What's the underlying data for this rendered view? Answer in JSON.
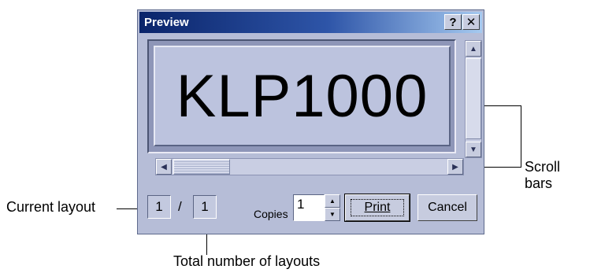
{
  "dialog": {
    "title": "Preview",
    "help_label": "?",
    "close_label": "✕"
  },
  "preview": {
    "label_text": "KLP1000"
  },
  "controls": {
    "current_layout": "1",
    "separator": "/",
    "total_layouts": "1",
    "copies_label": "Copies",
    "copies_value": "1",
    "print_label": "Print",
    "cancel_label": "Cancel"
  },
  "callouts": {
    "scroll_bars": "Scroll bars",
    "current_layout": "Current layout",
    "total_layouts": "Total number of layouts"
  }
}
